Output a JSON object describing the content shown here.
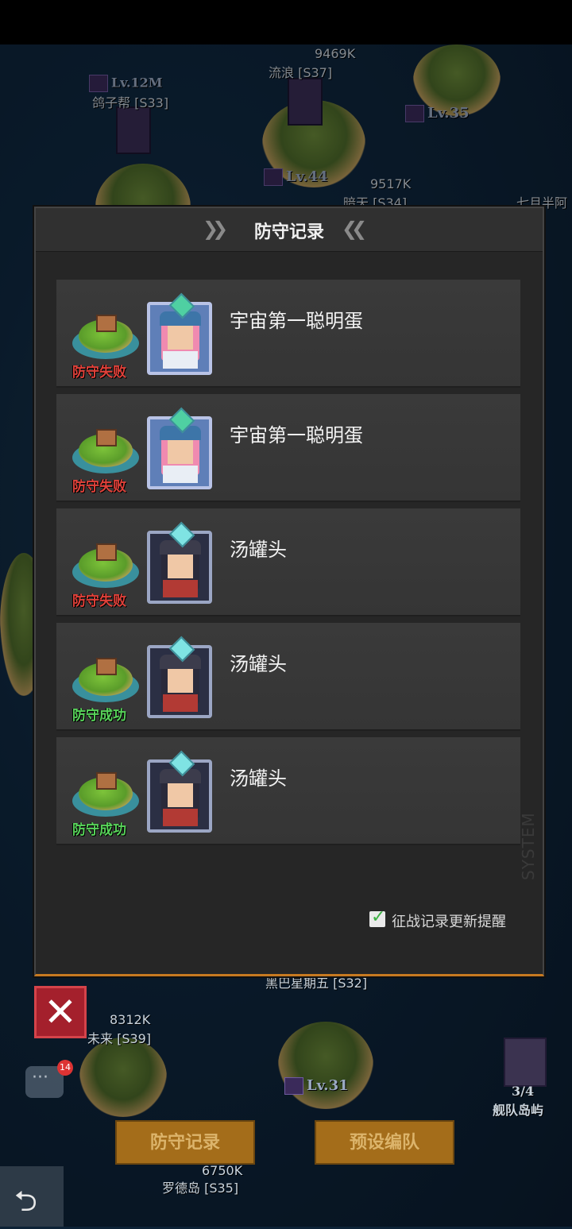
{
  "map": {
    "labels": [
      {
        "text": "9469K"
      },
      {
        "text": "流浪 [S37]"
      },
      {
        "text": "Lv.12M"
      },
      {
        "text": "鸽子帮 [S33]"
      },
      {
        "text": "Lv.35"
      },
      {
        "text": "Lv.44"
      },
      {
        "text": "9517K"
      },
      {
        "text": "暗天 [S34]"
      },
      {
        "text": "七月半阿"
      },
      {
        "text": "黑巴星期五 [S32]"
      },
      {
        "text": "8312K"
      },
      {
        "text": "未来 [S39]"
      },
      {
        "text": "Lv.31"
      },
      {
        "text": "6750K"
      },
      {
        "text": "罗德岛 [S35]"
      },
      {
        "text": "3/4"
      },
      {
        "text": "舰队岛屿"
      }
    ]
  },
  "dialog": {
    "title": "防守记录",
    "records": [
      {
        "player": "宇宙第一聪明蛋",
        "result": "防守失败",
        "status": "fail",
        "portrait": "pink-hair-star-frame"
      },
      {
        "player": "宇宙第一聪明蛋",
        "result": "防守失败",
        "status": "fail",
        "portrait": "pink-hair-star-frame"
      },
      {
        "player": "汤罐头",
        "result": "防守失败",
        "status": "fail",
        "portrait": "cap-boy-silver-frame"
      },
      {
        "player": "汤罐头",
        "result": "防守成功",
        "status": "success",
        "portrait": "cap-boy-silver-frame"
      },
      {
        "player": "汤罐头",
        "result": "防守成功",
        "status": "success",
        "portrait": "cap-boy-silver-frame"
      }
    ],
    "notify_label": "征战记录更新提醒",
    "notify_checked": true,
    "watermark": "SYSTEM"
  },
  "chat": {
    "badge": "14"
  },
  "bottom": {
    "defense_record_label": "防守记录",
    "preset_team_label": "预设编队"
  },
  "colors": {
    "fail": "#e0413a",
    "success": "#58d35a",
    "accent": "#c77a21"
  }
}
